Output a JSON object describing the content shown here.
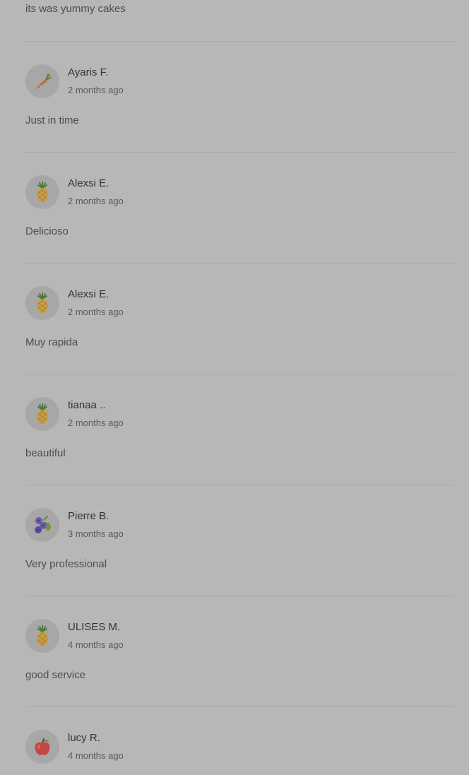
{
  "top_comment": "its was yummy cakes",
  "reviews": [
    {
      "name": "Ayaris F.",
      "time": "2 months ago",
      "comment": "Just in time",
      "avatar_icon": "carrot-icon"
    },
    {
      "name": "Alexsi E.",
      "time": "2 months ago",
      "comment": "Delicioso",
      "avatar_icon": "pineapple-icon"
    },
    {
      "name": "Alexsi E.",
      "time": "2 months ago",
      "comment": "Muy rapida",
      "avatar_icon": "pineapple-icon"
    },
    {
      "name": "tianaa ..",
      "time": "2 months ago",
      "comment": "beautiful",
      "avatar_icon": "pineapple-icon"
    },
    {
      "name": "Pierre B.",
      "time": "3 months ago",
      "comment": "Very professional",
      "avatar_icon": "blueberries-icon"
    },
    {
      "name": "ULISES M.",
      "time": "4 months ago",
      "comment": "good service",
      "avatar_icon": "pineapple-icon"
    },
    {
      "name": "lucy R.",
      "time": "4 months ago",
      "comment": "",
      "avatar_icon": "apple-icon"
    }
  ],
  "colors": {
    "background": "#b7b7b7",
    "divider": "#a8a8a8",
    "name_text": "#333333",
    "secondary_text": "#5a5a5a"
  }
}
